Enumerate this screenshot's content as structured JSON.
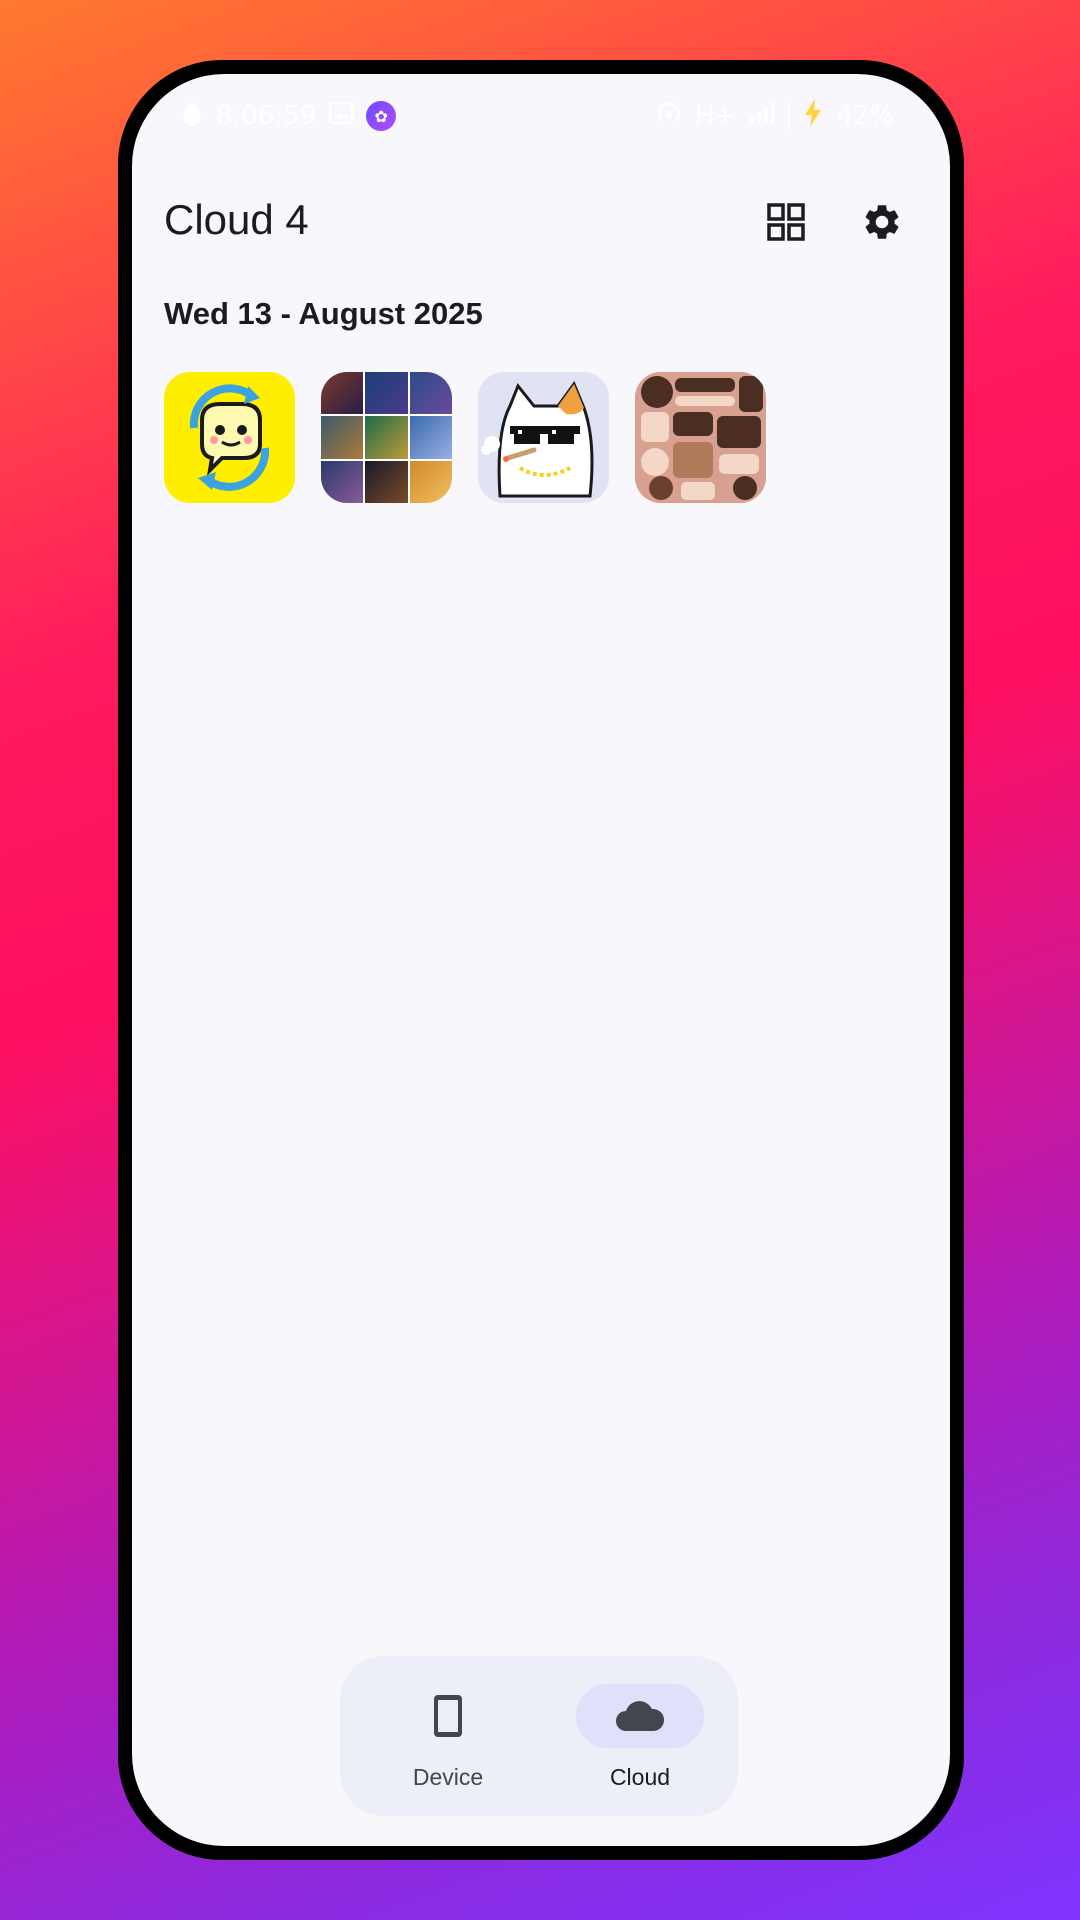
{
  "status_bar": {
    "time": "8:06:59",
    "network": "H+",
    "battery": "42%",
    "icons": [
      "water-drop-icon",
      "image-icon",
      "app-badge-icon",
      "hotspot-icon",
      "signal-icon",
      "charging-icon"
    ]
  },
  "header": {
    "title": "Cloud 4",
    "grid_view_icon": "grid-view-icon",
    "settings_icon": "gear-icon"
  },
  "gallery": {
    "sections": [
      {
        "date_label": "Wed 13 - August 2025",
        "items": [
          {
            "kind": "chat-sync-sticker"
          },
          {
            "kind": "photo-collage"
          },
          {
            "kind": "cat-sunglasses-sticker"
          },
          {
            "kind": "widgets-screenshot"
          }
        ]
      }
    ]
  },
  "bottom_nav": {
    "items": [
      {
        "label": "Device",
        "icon": "smartphone-icon",
        "selected": false
      },
      {
        "label": "Cloud",
        "icon": "cloud-icon",
        "selected": true
      }
    ]
  },
  "colors": {
    "accent_pill": "#dfe0fa",
    "nav_background": "#eceef8",
    "screen_background": "#f7f7fc"
  }
}
